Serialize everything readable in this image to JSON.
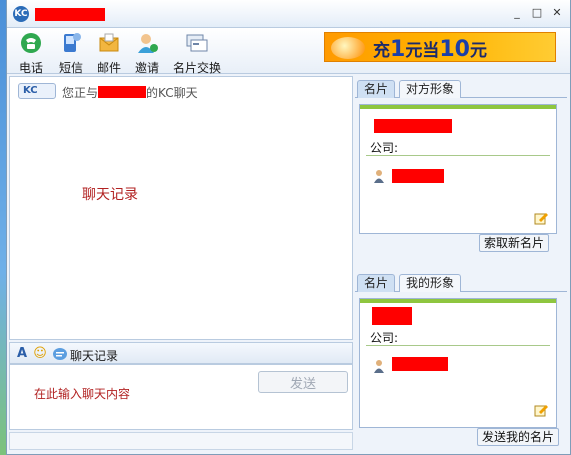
{
  "window": {
    "app_icon_text": "KC",
    "controls": {
      "minimize": "_",
      "maximize": "□",
      "close": "✕"
    }
  },
  "toolbar": {
    "items": [
      {
        "label": "电话",
        "icon": "phone-icon"
      },
      {
        "label": "短信",
        "icon": "sms-icon"
      },
      {
        "label": "邮件",
        "icon": "mail-icon"
      },
      {
        "label": "邀请",
        "icon": "invite-icon"
      },
      {
        "label": "名片交换",
        "icon": "card-exchange-icon"
      }
    ],
    "banner": {
      "pre": "充",
      "num1": "1",
      "mid": "元当",
      "num2": "10",
      "post": "元"
    }
  },
  "chat": {
    "kc_badge": "KC",
    "status_prefix": "您正与",
    "status_suffix": "的KC聊天",
    "log_label": "聊天记录"
  },
  "input_toolbar": {
    "font_icon": "A",
    "emoji_icon": "☺",
    "history_label": "聊天记录"
  },
  "input": {
    "placeholder": "在此输入聊天内容",
    "send_label": "发送"
  },
  "peer_panel": {
    "tabs": [
      {
        "label": "名片",
        "active": true
      },
      {
        "label": "对方形象",
        "active": false
      }
    ],
    "company_label": "公司:",
    "action_label": "索取新名片"
  },
  "self_panel": {
    "tabs": [
      {
        "label": "名片",
        "active": true
      },
      {
        "label": "我的形象",
        "active": false
      }
    ],
    "company_label": "公司:",
    "action_label": "发送我的名片"
  },
  "colors": {
    "redaction": "#ff0000",
    "accent_green": "#8ec63f",
    "banner_orange": "#ffb300"
  }
}
